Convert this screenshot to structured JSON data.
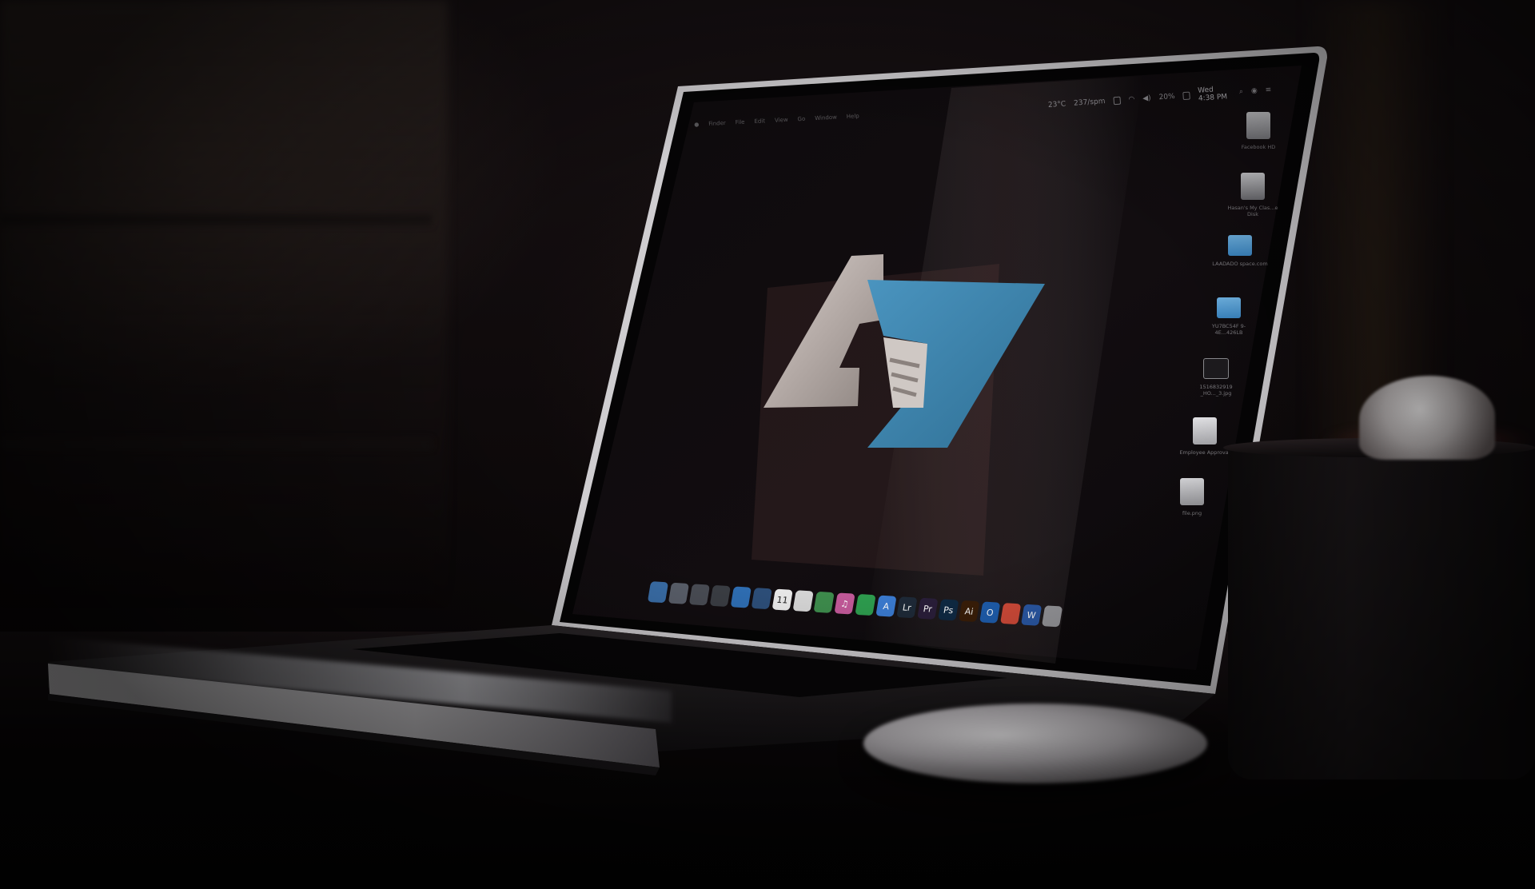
{
  "scene": {
    "description_colors": {
      "background": "#0c0809",
      "logo_gray": "#b8aeab",
      "logo_blue": "#3f82a8",
      "screen": "#0b090b"
    }
  },
  "menubar": {
    "items": [
      "Finder",
      "File",
      "Edit",
      "View",
      "Go",
      "Window",
      "Help"
    ],
    "weather": "23°C",
    "network_rate": "237/spm",
    "battery": "20%",
    "clock": "Wed 4:38 PM"
  },
  "desktop_icons": [
    {
      "label": "Facebook HD",
      "kind": "drive"
    },
    {
      "label": "Hasan's My Clas...e Disk",
      "kind": "drive"
    },
    {
      "label": "LAADADO space.com",
      "kind": "folder"
    },
    {
      "label": "YU7BC54F 9-4E...426LB",
      "kind": "folder"
    },
    {
      "label": "1516832919 _HO..._3.jpg",
      "kind": "image"
    },
    {
      "label": "Employee Approval",
      "kind": "document"
    },
    {
      "label": "file.png",
      "kind": "image"
    }
  ],
  "dock": [
    {
      "name": "finder-icon",
      "glyph": "",
      "color": "#3a6ea8"
    },
    {
      "name": "launchpad-icon",
      "glyph": "",
      "color": "#5a5f6a"
    },
    {
      "name": "photos-icon",
      "glyph": "",
      "color": "#4a4d55"
    },
    {
      "name": "camera-icon",
      "glyph": "",
      "color": "#3b3e44"
    },
    {
      "name": "safari-icon",
      "glyph": "",
      "color": "#2f6fb5"
    },
    {
      "name": "preview-icon",
      "glyph": "",
      "color": "#2d4f7a"
    },
    {
      "name": "calendar-icon",
      "glyph": "11",
      "color": "#ececec"
    },
    {
      "name": "notes-icon",
      "glyph": "",
      "color": "#d8d8d8"
    },
    {
      "name": "facetime-icon",
      "glyph": "",
      "color": "#3e8d4d"
    },
    {
      "name": "itunes-icon",
      "glyph": "♫",
      "color": "#c45a9a"
    },
    {
      "name": "whatsapp-icon",
      "glyph": "",
      "color": "#2e9e4f"
    },
    {
      "name": "app-store-icon",
      "glyph": "A",
      "color": "#3b7cd2"
    },
    {
      "name": "lightroom-icon",
      "glyph": "Lr",
      "color": "#1e2a38"
    },
    {
      "name": "premiere-icon",
      "glyph": "Pr",
      "color": "#2a1e3a"
    },
    {
      "name": "photoshop-icon",
      "glyph": "Ps",
      "color": "#0f2a44"
    },
    {
      "name": "illustrator-icon",
      "glyph": "Ai",
      "color": "#3a1e08"
    },
    {
      "name": "outlook-icon",
      "glyph": "O",
      "color": "#1f5fb0"
    },
    {
      "name": "chrome-icon",
      "glyph": "",
      "color": "#d44c3a"
    },
    {
      "name": "word-icon",
      "glyph": "W",
      "color": "#2b5aa8"
    },
    {
      "name": "trash-icon",
      "glyph": "",
      "color": "#9a9a9e"
    }
  ]
}
